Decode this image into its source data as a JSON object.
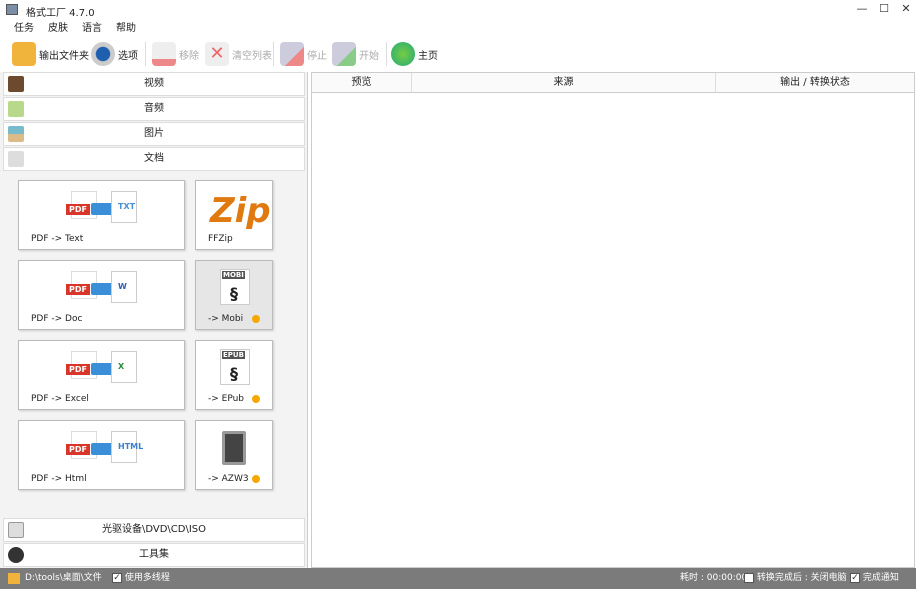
{
  "window": {
    "title": "格式工厂 4.7.0",
    "min": "—",
    "max": "☐",
    "close": "✕"
  },
  "menu": [
    "任务",
    "皮肤",
    "语言",
    "帮助"
  ],
  "toolbar": {
    "output_folder": "输出文件夹",
    "options": "选项",
    "remove": "移除",
    "clear_list": "清空列表",
    "stop": "停止",
    "start": "开始",
    "home": "主页"
  },
  "categories": {
    "video": "视频",
    "audio": "音频",
    "image": "图片",
    "document": "文档",
    "optical": "光驱设备\\DVD\\CD\\ISO",
    "tools": "工具集"
  },
  "tiles": [
    {
      "label": "PDF -> Text",
      "badge": "TXT"
    },
    {
      "label": "FFZip",
      "badge": "Zip"
    },
    {
      "label": "PDF -> Doc",
      "badge": "W"
    },
    {
      "label": "-> Mobi",
      "badge": "MOBI"
    },
    {
      "label": "PDF -> Excel",
      "badge": "X"
    },
    {
      "label": "-> EPub",
      "badge": "EPUB"
    },
    {
      "label": "PDF -> Html",
      "badge": "HTML"
    },
    {
      "label": "-> AZW3",
      "badge": ""
    }
  ],
  "pdf_label": "PDF",
  "table": {
    "columns": [
      "预览",
      "来源",
      "输出 / 转换状态"
    ]
  },
  "status": {
    "path": "D:\\tools\\桌面\\文件",
    "multithread": "使用多线程",
    "multithread_checked": true,
    "elapsed": "耗时 : 00:00:00",
    "after_done": "转换完成后 : 关闭电脑",
    "after_done_checked": false,
    "notify": "完成通知",
    "notify_checked": true
  },
  "colors": {
    "status_bg": "#7b7b7b",
    "dot": "#f5a800",
    "pdf_red": "#d9362b"
  }
}
